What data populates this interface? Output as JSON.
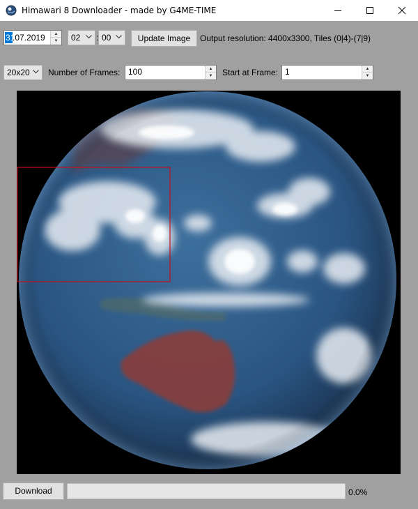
{
  "window": {
    "title": "Himawari 8 Downloader - made by G4ME-TIME",
    "icon": "globe-app-icon"
  },
  "controls": {
    "date": {
      "selected_part": "31",
      "rest": ".07.2019"
    },
    "hour": "02",
    "separator": ":",
    "minute": "00",
    "update_button": "Update Image",
    "resolution_text": "Output resolution: 4400x3300, Tiles (0|4)-(7|9)",
    "grid_size": "20x20",
    "frames_label": "Number of Frames:",
    "frames_value": "100",
    "start_label": "Start at Frame:",
    "start_value": "1"
  },
  "preview": {
    "description_icon": "earth-image",
    "selection_color": "#c0111a"
  },
  "footer": {
    "download_button": "Download",
    "progress": 0.0,
    "progress_text": "0.0%"
  }
}
